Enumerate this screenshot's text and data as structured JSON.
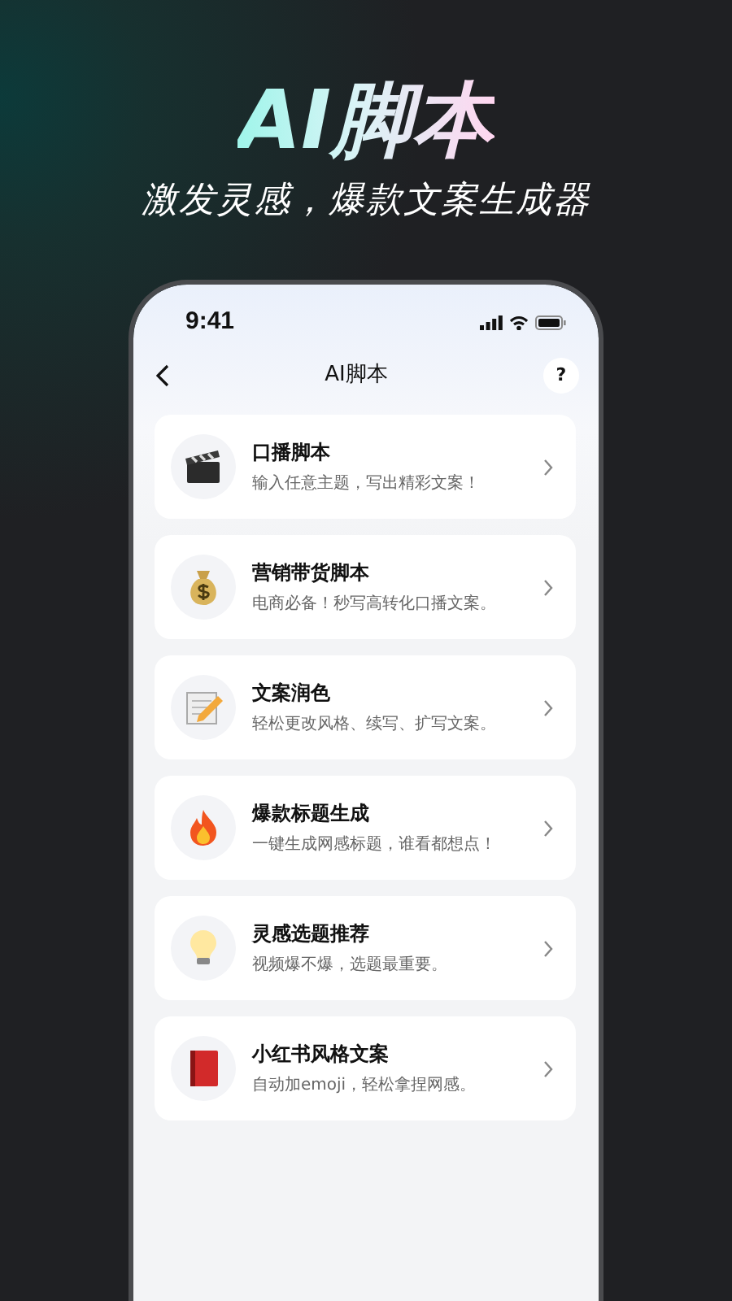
{
  "hero": {
    "title": "AI脚本",
    "subtitle": "激发灵感，爆款文案生成器"
  },
  "status_bar": {
    "time": "9:41"
  },
  "nav": {
    "title": "AI脚本",
    "help": "?"
  },
  "items": [
    {
      "kind": "clapper",
      "title": "口播脚本",
      "desc": "输入任意主题，写出精彩文案！"
    },
    {
      "kind": "moneybag",
      "title": "营销带货脚本",
      "desc": "电商必备！秒写高转化口播文案。"
    },
    {
      "kind": "memo",
      "title": "文案润色",
      "desc": "轻松更改风格、续写、扩写文案。"
    },
    {
      "kind": "fire",
      "title": "爆款标题生成",
      "desc": "一键生成网感标题，谁看都想点！"
    },
    {
      "kind": "bulb",
      "title": "灵感选题推荐",
      "desc": "视频爆不爆，选题最重要。"
    },
    {
      "kind": "book",
      "title": "小红书风格文案",
      "desc": "自动加emoji，轻松拿捏网感。"
    }
  ]
}
